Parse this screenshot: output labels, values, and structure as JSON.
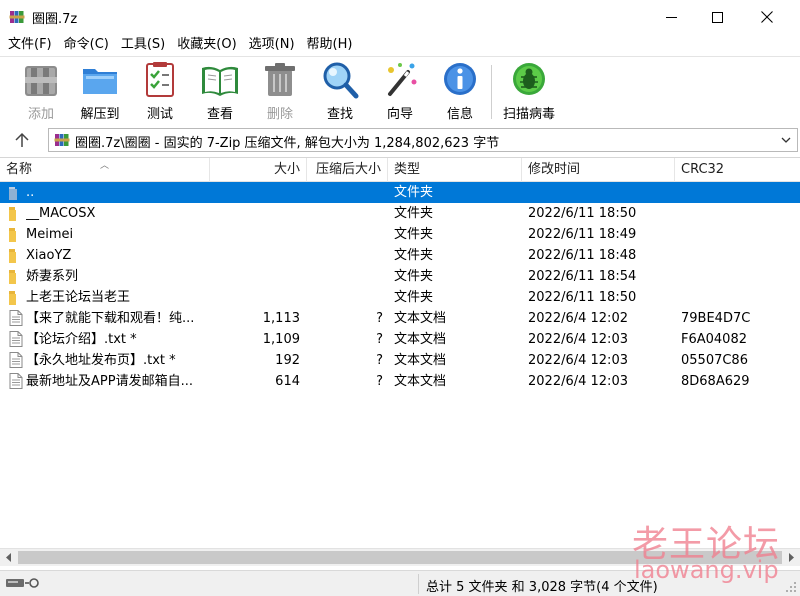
{
  "window": {
    "title": "圈圈.7z",
    "app_icon": "winrar-books-icon"
  },
  "menu": [
    "文件(F)",
    "命令(C)",
    "工具(S)",
    "收藏夹(O)",
    "选项(N)",
    "帮助(H)"
  ],
  "toolbar": {
    "add": "添加",
    "extract": "解压到",
    "test": "测试",
    "view": "查看",
    "delete": "删除",
    "find": "查找",
    "wizard": "向导",
    "info": "信息",
    "scan": "扫描病毒"
  },
  "address": {
    "path": "圈圈.7z\\圈圈 - 固实的 7-Zip 压缩文件, 解包大小为 1,284,802,623 字节"
  },
  "columns": {
    "name": "名称",
    "size": "大小",
    "packed": "压缩后大小",
    "type": "类型",
    "modified": "修改时间",
    "crc": "CRC32"
  },
  "files": [
    {
      "name": "..",
      "size": "",
      "packed": "",
      "type": "文件夹",
      "modified": "",
      "crc": "",
      "icon": "folder-up"
    },
    {
      "name": "__MACOSX",
      "size": "",
      "packed": "",
      "type": "文件夹",
      "modified": "2022/6/11 18:50",
      "crc": "",
      "icon": "folder"
    },
    {
      "name": "Meimei",
      "size": "",
      "packed": "",
      "type": "文件夹",
      "modified": "2022/6/11 18:49",
      "crc": "",
      "icon": "folder"
    },
    {
      "name": "XiaoYZ",
      "size": "",
      "packed": "",
      "type": "文件夹",
      "modified": "2022/6/11 18:48",
      "crc": "",
      "icon": "folder"
    },
    {
      "name": "娇妻系列",
      "size": "",
      "packed": "",
      "type": "文件夹",
      "modified": "2022/6/11 18:54",
      "crc": "",
      "icon": "folder"
    },
    {
      "name": "上老王论坛当老王",
      "size": "",
      "packed": "",
      "type": "文件夹",
      "modified": "2022/6/11 18:50",
      "crc": "",
      "icon": "folder"
    },
    {
      "name": "【来了就能下载和观看！纯...",
      "size": "1,113",
      "packed": "?",
      "type": "文本文档",
      "modified": "2022/6/4 12:02",
      "crc": "79BE4D7C",
      "icon": "text-file"
    },
    {
      "name": "【论坛介绍】.txt *",
      "size": "1,109",
      "packed": "?",
      "type": "文本文档",
      "modified": "2022/6/4 12:03",
      "crc": "F6A04082",
      "icon": "text-file"
    },
    {
      "name": "【永久地址发布页】.txt *",
      "size": "192",
      "packed": "?",
      "type": "文本文档",
      "modified": "2022/6/4 12:03",
      "crc": "05507C86",
      "icon": "text-file"
    },
    {
      "name": "最新地址及APP请发邮箱自...",
      "size": "614",
      "packed": "?",
      "type": "文本文档",
      "modified": "2022/6/4 12:03",
      "crc": "8D68A629",
      "icon": "text-file"
    }
  ],
  "status": {
    "summary": "总计 5 文件夹 和 3,028 字节(4 个文件)"
  },
  "watermark": {
    "cn": "老王论坛",
    "en": "laowang.vip"
  },
  "colors": {
    "selection": "#0078d7",
    "folder": "#e8b53a",
    "watermark": "#f07f8f"
  }
}
